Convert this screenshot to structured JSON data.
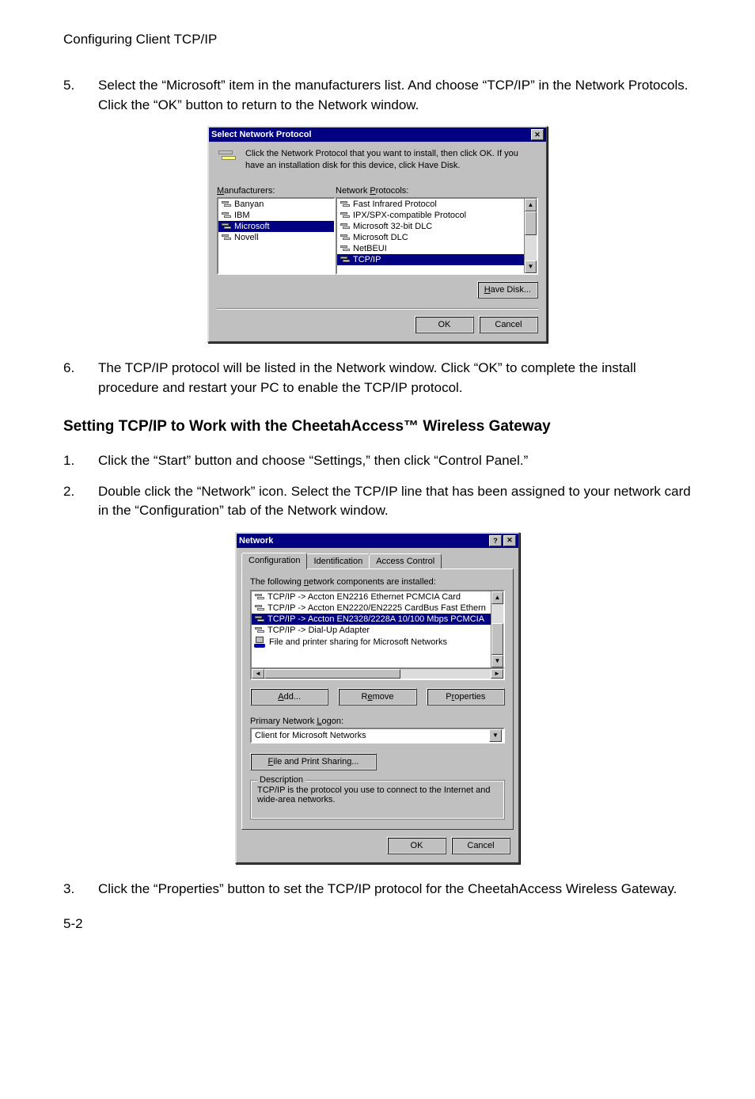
{
  "header": "Configuring Client TCP/IP",
  "step5": {
    "num": "5.",
    "text": "Select the “Microsoft” item in the manufacturers list. And choose “TCP/IP” in the Network Protocols. Click the “OK” button to return to the Network window."
  },
  "dialog1": {
    "title": "Select Network Protocol",
    "intro": "Click the Network Protocol that you want to install, then click OK. If you have an installation disk for this device, click Have Disk.",
    "manufacturers_label": "Manufacturers:",
    "protocols_label": "Network Protocols:",
    "manufacturers": [
      "Banyan",
      "IBM",
      "Microsoft",
      "Novell"
    ],
    "protocols": [
      "Fast Infrared Protocol",
      "IPX/SPX-compatible Protocol",
      "Microsoft 32-bit DLC",
      "Microsoft DLC",
      "NetBEUI",
      "TCP/IP"
    ],
    "have_disk": "Have Disk...",
    "ok": "OK",
    "cancel": "Cancel"
  },
  "step6": {
    "num": "6.",
    "text": "The TCP/IP protocol will be listed in the Network window. Click “OK” to complete the install procedure and restart your PC to enable the TCP/IP protocol."
  },
  "section_heading": "Setting TCP/IP to Work with the CheetahAccess™ Wireless Gateway",
  "stepA": {
    "num": "1.",
    "text": "Click the “Start” button and choose “Settings,” then click “Control Panel.”"
  },
  "stepB": {
    "num": "2.",
    "text": "Double click the “Network” icon. Select the TCP/IP line that has been assigned to your network card in the “Configuration” tab of the Network window."
  },
  "dialog2": {
    "title": "Network",
    "tabs": {
      "config": "Configuration",
      "ident": "Identification",
      "access": "Access Control"
    },
    "list_label": "The following network components are installed:",
    "components": [
      "TCP/IP -> Accton EN2216 Ethernet PCMCIA Card",
      "TCP/IP -> Accton EN2220/EN2225 CardBus Fast Ethern",
      "TCP/IP -> Accton EN2328/2228A 10/100 Mbps PCMCIA",
      "TCP/IP -> Dial-Up Adapter",
      "File and printer sharing for Microsoft Networks"
    ],
    "add": "Add...",
    "remove": "Remove",
    "properties": "Properties",
    "primary_label": "Primary Network Logon:",
    "primary_value": "Client for Microsoft Networks",
    "file_print": "File and Print Sharing...",
    "desc_title": "Description",
    "desc_text": "TCP/IP is the protocol you use to connect to the Internet and wide-area networks.",
    "ok": "OK",
    "cancel": "Cancel"
  },
  "stepC": {
    "num": "3.",
    "text": "Click the “Properties” button to set the TCP/IP protocol for the CheetahAccess Wireless Gateway."
  },
  "page_number": "5-2"
}
